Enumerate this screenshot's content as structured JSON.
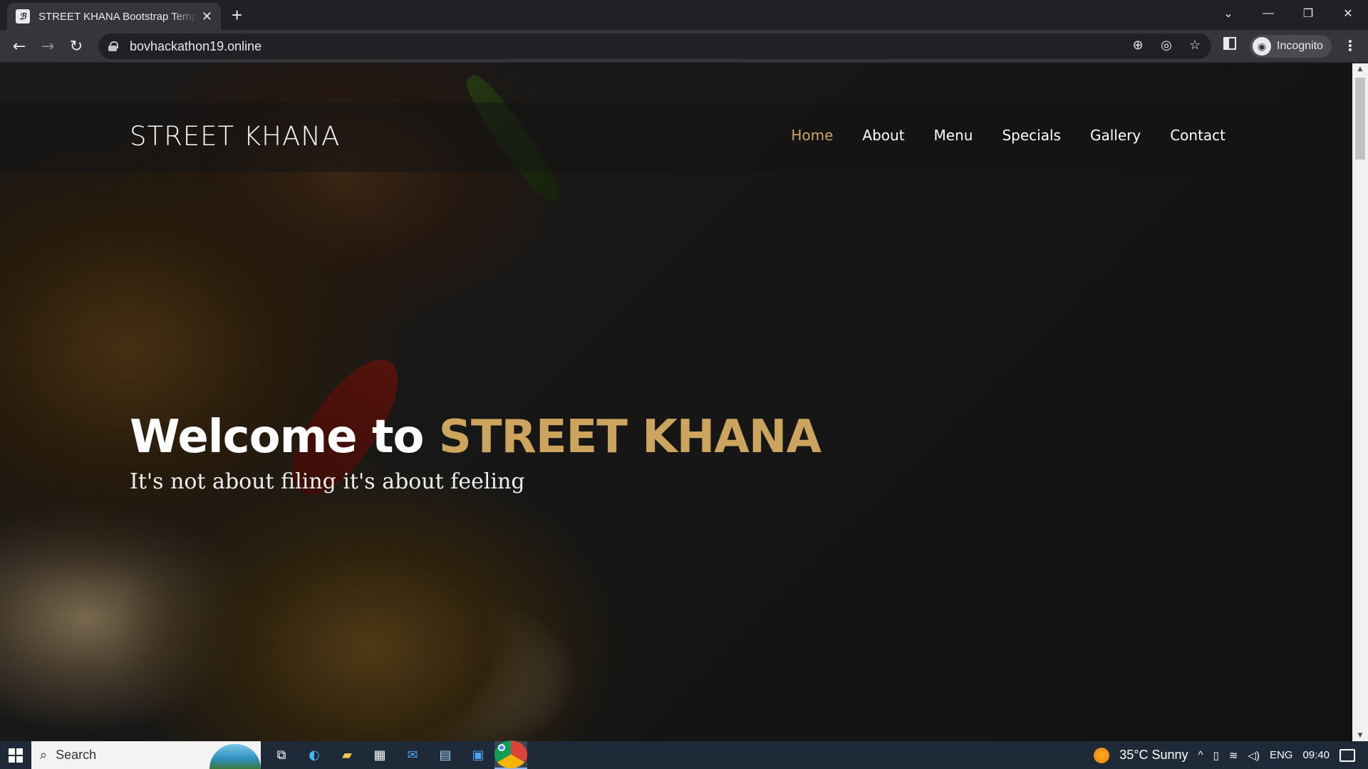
{
  "browser": {
    "tab_title": "STREET KHANA Bootstrap Template",
    "favicon_glyph": "ℬ",
    "tab_close": "✕",
    "new_tab": "+",
    "url": "bovhackathon19.online",
    "profile_label": "Incognito",
    "window_controls": {
      "dropdown": "⌄",
      "minimize": "—",
      "restore": "❐",
      "close": "✕"
    },
    "nav": {
      "back": "←",
      "forward": "→",
      "reload": "↻"
    },
    "omni_icons": {
      "zoom": "⊕",
      "eye_off": "◎",
      "bookmark": "☆"
    },
    "menu": "⋮"
  },
  "site": {
    "brand": "STREET KHANA",
    "nav_items": [
      {
        "label": "Home",
        "active": true
      },
      {
        "label": "About",
        "active": false
      },
      {
        "label": "Menu",
        "active": false
      },
      {
        "label": "Specials",
        "active": false
      },
      {
        "label": "Gallery",
        "active": false
      },
      {
        "label": "Contact",
        "active": false
      }
    ],
    "hero": {
      "welcome": "Welcome to ",
      "brand_accent": "STREET KHANA",
      "tagline": "It's not about filing it's about feeling"
    },
    "accent_color": "#cda45e"
  },
  "taskbar": {
    "search_label": "Search",
    "weather": "35°C  Sunny",
    "language": "ENG",
    "time": "09:40",
    "tray_chevron": "^"
  }
}
